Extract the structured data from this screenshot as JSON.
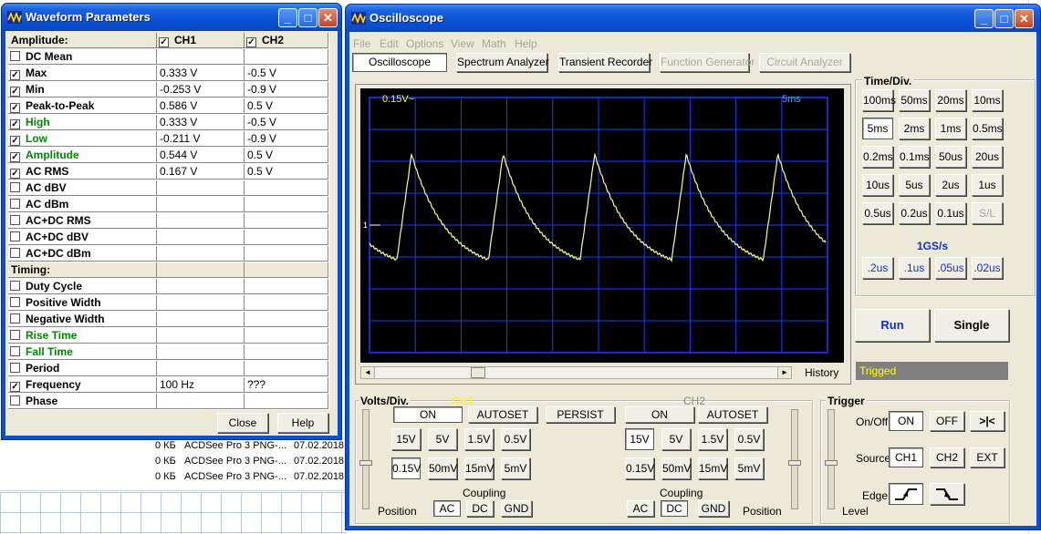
{
  "background_app": {
    "rows": [
      {
        "size": "0 КБ",
        "name": "ACDSee Pro 3 PNG-...",
        "date": "07.02.2018"
      },
      {
        "size": "0 КБ",
        "name": "ACDSee Pro 3 PNG-...",
        "date": "07.02.2018"
      },
      {
        "size": "0 КБ",
        "name": "ACDSee Pro 3 PNG-...",
        "date": "07.02.2018"
      }
    ]
  },
  "waveform_window": {
    "title": "Waveform Parameters",
    "header": {
      "label": "Amplitude:",
      "ch1": "CH1",
      "ch2": "CH2"
    },
    "rows": [
      {
        "label": "DC  Mean",
        "checked": false,
        "color": "black",
        "ch1": "",
        "ch2": ""
      },
      {
        "label": "Max",
        "checked": true,
        "color": "black",
        "ch1": "0.333 V",
        "ch2": "-0.5 V"
      },
      {
        "label": "Min",
        "checked": true,
        "color": "black",
        "ch1": "-0.253 V",
        "ch2": "-0.9 V"
      },
      {
        "label": "Peak-to-Peak",
        "checked": true,
        "color": "black",
        "ch1": "0.586 V",
        "ch2": "0.5 V"
      },
      {
        "label": "High",
        "checked": true,
        "color": "green",
        "ch1": "0.333 V",
        "ch2": "-0.5 V"
      },
      {
        "label": "Low",
        "checked": true,
        "color": "green",
        "ch1": "-0.211 V",
        "ch2": "-0.9 V"
      },
      {
        "label": "Amplitude",
        "checked": true,
        "color": "green",
        "ch1": "0.544 V",
        "ch2": "0.5 V"
      },
      {
        "label": "AC RMS",
        "checked": true,
        "color": "black",
        "ch1": "0.167 V",
        "ch2": "0.5 V"
      },
      {
        "label": "AC dBV",
        "checked": false,
        "color": "black",
        "ch1": "",
        "ch2": ""
      },
      {
        "label": "AC dBm",
        "checked": false,
        "color": "black",
        "ch1": "",
        "ch2": ""
      },
      {
        "label": "AC+DC RMS",
        "checked": false,
        "color": "black",
        "ch1": "",
        "ch2": ""
      },
      {
        "label": "AC+DC dBV",
        "checked": false,
        "color": "black",
        "ch1": "",
        "ch2": ""
      },
      {
        "label": "AC+DC dBm",
        "checked": false,
        "color": "black",
        "ch1": "",
        "ch2": ""
      },
      {
        "label": "Timing:",
        "section": true,
        "ch1": "",
        "ch2": ""
      },
      {
        "label": "Duty Cycle",
        "checked": false,
        "color": "black",
        "ch1": "",
        "ch2": ""
      },
      {
        "label": "Positive Width",
        "checked": false,
        "color": "black",
        "ch1": "",
        "ch2": ""
      },
      {
        "label": "Negative Width",
        "checked": false,
        "color": "black",
        "ch1": "",
        "ch2": ""
      },
      {
        "label": "Rise Time",
        "checked": false,
        "color": "green",
        "ch1": "",
        "ch2": ""
      },
      {
        "label": "Fall Time",
        "checked": false,
        "color": "green",
        "ch1": "",
        "ch2": ""
      },
      {
        "label": "Period",
        "checked": false,
        "color": "black",
        "ch1": "",
        "ch2": ""
      },
      {
        "label": "Frequency",
        "checked": true,
        "color": "black",
        "ch1": "100 Hz",
        "ch2": "???"
      },
      {
        "label": "Phase",
        "checked": false,
        "color": "black",
        "ch1": "",
        "ch2": ""
      }
    ],
    "close_label": "Close",
    "help_label": "Help"
  },
  "osc_window": {
    "title": "Oscilloscope",
    "menu": [
      "File",
      "Edit",
      "Options",
      "View",
      "Math",
      "Help"
    ],
    "modes": [
      {
        "label": "Oscilloscope",
        "state": "pressed"
      },
      {
        "label": "Spectrum Analyzer",
        "state": "normal"
      },
      {
        "label": "Transient Recorder",
        "state": "normal"
      },
      {
        "label": "Function Generator",
        "state": "disabled"
      },
      {
        "label": "Circuit Analyzer",
        "state": "disabled"
      }
    ],
    "screen": {
      "volts_readout": "0.15V~",
      "time_readout": "5ms",
      "marker": "1"
    },
    "history_label": "History",
    "time_div": {
      "title": "Time/Div.",
      "rows": [
        [
          "100ms",
          "50ms",
          "20ms",
          "10ms"
        ],
        [
          "5ms",
          "2ms",
          "1ms",
          "0.5ms"
        ],
        [
          "0.2ms",
          "0.1ms",
          "50us",
          "20us"
        ],
        [
          "10us",
          "5us",
          "2us",
          "1us"
        ],
        [
          "0.5us",
          "0.2us",
          "0.1us",
          "S/L"
        ]
      ],
      "selected": "5ms",
      "rate_label": "1GS/s",
      "fast_row": [
        ".2us",
        ".1us",
        ".05us",
        ".02us"
      ]
    },
    "run_label": "Run",
    "single_label": "Single",
    "status": "Trigged",
    "volts_div": {
      "title": "Volts/Div.",
      "ch1_label": "CH1",
      "ch2_label": "CH2",
      "on_label": "ON",
      "autoset_label": "AUTOSET",
      "persist_label": "PERSIST",
      "ranges_row1": [
        "15V",
        "5V",
        "1.5V",
        "0.5V"
      ],
      "ranges_row2": [
        "0.15V",
        "50mV",
        "15mV",
        "5mV"
      ],
      "ch1_selected": "0.15V",
      "ch2_selected": "15V",
      "coupling_label": "Coupling",
      "position_label": "Position",
      "coupling": [
        "AC",
        "DC",
        "GND"
      ],
      "ch1_coupling": "AC",
      "ch2_coupling": "DC"
    },
    "trigger": {
      "title": "Trigger",
      "onoff_label": "On/Off",
      "on": "ON",
      "off": "OFF",
      "special": ">|<",
      "source_label": "Source",
      "sources": [
        "CH1",
        "CH2",
        "EXT"
      ],
      "edge_label": "Edge",
      "level_label": "Level"
    }
  },
  "colors": {
    "trace": "#ffff80",
    "grid": "#1a3cff",
    "readout": "#ffff00",
    "status_bg": "#808080",
    "status_fg": "#ffff00"
  }
}
